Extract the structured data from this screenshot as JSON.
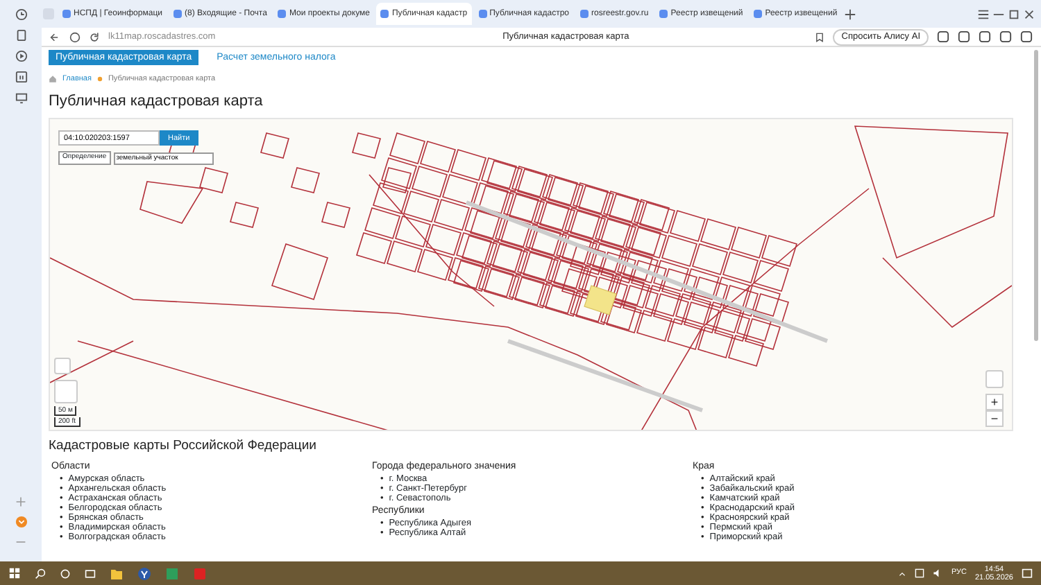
{
  "browser": {
    "tabs": [
      {
        "title": "НСПД | Геоинформаци",
        "selected": false
      },
      {
        "title": "(8) Входящие - Почта",
        "selected": false
      },
      {
        "title": "Мои проекты докуме",
        "selected": false
      },
      {
        "title": "Публичная кадастр",
        "selected": true
      },
      {
        "title": "Публичная кадастро",
        "selected": false
      },
      {
        "title": "rosreestr.gov.ru",
        "selected": false
      },
      {
        "title": "Реестр извещений",
        "selected": false
      },
      {
        "title": "Реестр извещений",
        "selected": false
      }
    ],
    "address": "lk11map.roscadastres.com",
    "page_title": "Публичная кадастровая карта",
    "assistant_button": "Спросить Алису AI"
  },
  "page": {
    "nav": [
      {
        "label": "Публичная кадастровая карта",
        "selected": true
      },
      {
        "label": "Расчет земельного налога",
        "selected": false
      }
    ],
    "breadcrumb": [
      "Главная",
      "Публичная кадастровая карта"
    ],
    "heading": "Публичная кадастровая карта",
    "map": {
      "search": {
        "value": "04:10:020203:1597"
      },
      "search_button": "Найти",
      "mode_label": "Определение",
      "mode_select": "земельный участок",
      "scale": [
        "50 м",
        "200 ft"
      ],
      "zoom_in": "+",
      "zoom_out": "−"
    },
    "regions": {
      "title": "Кадастровые карты Российской Федерации",
      "marker": "•",
      "columns": [
        {
          "groups": [
            {
              "heading": "Области",
              "items": [
                "Амурская область",
                "Архангельская область",
                "Астраханская область",
                "Белгородская область",
                "Брянская область",
                "Владимирская область",
                "Волгоградская область"
              ]
            }
          ]
        },
        {
          "groups": [
            {
              "heading": "Города федерального значения",
              "items": [
                "г. Москва",
                "г. Санкт-Петербург",
                "г. Севастополь"
              ]
            },
            {
              "heading": "Республики",
              "items": [
                "Республика Адыгея",
                "Республика Алтай"
              ]
            }
          ]
        },
        {
          "groups": [
            {
              "heading": "Края",
              "items": [
                "Алтайский край",
                "Забайкальский край",
                "Камчатский край",
                "Краснодарский край",
                "Красноярский край",
                "Пермский край",
                "Приморский край"
              ]
            }
          ]
        }
      ]
    }
  },
  "taskbar": {
    "language": "РУС",
    "time": "14:54",
    "date": "21.05.2026"
  }
}
